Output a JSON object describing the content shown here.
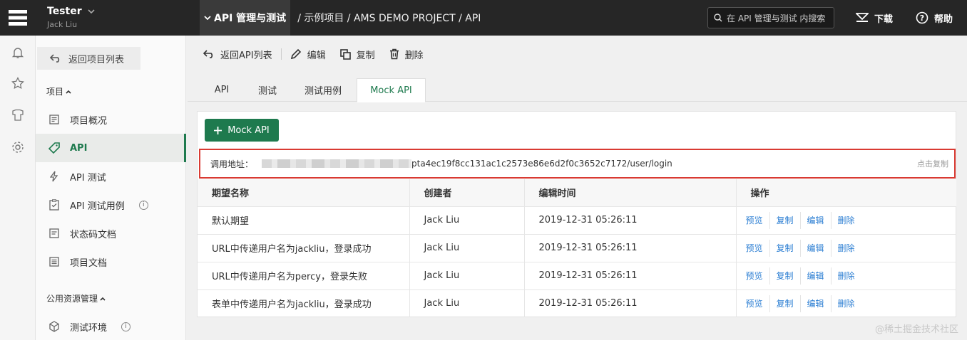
{
  "user": {
    "name": "Tester",
    "sub": "Jack Liu"
  },
  "breadcrumb": {
    "current": "API 管理与测试",
    "rest": "/ 示例项目 / AMS DEMO PROJECT / API"
  },
  "search": {
    "placeholder": "在 API 管理与测试 内搜索"
  },
  "header": {
    "download": "下载",
    "help": "帮助"
  },
  "sidebar": {
    "back": "返回项目列表",
    "section_project": "项目",
    "items": [
      {
        "label": "项目概况"
      },
      {
        "label": "API"
      },
      {
        "label": "API 测试"
      },
      {
        "label": "API 测试用例"
      },
      {
        "label": "状态码文档"
      },
      {
        "label": "项目文档"
      }
    ],
    "section_public": "公用资源管理",
    "public_items": [
      {
        "label": "测试环境"
      }
    ]
  },
  "toolbar": {
    "back": "返回API列表",
    "edit": "编辑",
    "copy": "复制",
    "delete": "删除"
  },
  "tabs": [
    "API",
    "测试",
    "测试用例",
    "Mock API"
  ],
  "mock": {
    "add_button": "Mock API",
    "address_label": "调用地址：",
    "address_url": "pta4ec19f8cc131ac1c2573e86e6d2f0c3652c7172/user/login",
    "copy_link": "点击复制"
  },
  "table": {
    "headers": [
      "期望名称",
      "创建者",
      "编辑时间",
      "操作"
    ],
    "rows": [
      {
        "name": "默认期望",
        "creator": "Jack Liu",
        "time": "2019-12-31 05:26:11"
      },
      {
        "name": "URL中传递用户名为jackliu，登录成功",
        "creator": "Jack Liu",
        "time": "2019-12-31 05:26:11"
      },
      {
        "name": "URL中传递用户名为percy，登录失败",
        "creator": "Jack Liu",
        "time": "2019-12-31 05:26:11"
      },
      {
        "name": "表单中传递用户名为jackliu，登录成功",
        "creator": "Jack Liu",
        "time": "2019-12-31 05:26:11"
      }
    ],
    "ops": [
      "预览",
      "复制",
      "编辑",
      "删除"
    ]
  },
  "watermark": "@稀土掘金技术社区",
  "colors": {
    "accent": "#1e7a4e",
    "topbar": "#262626",
    "highlight": "#d93a32",
    "link": "#2d7fd3"
  }
}
